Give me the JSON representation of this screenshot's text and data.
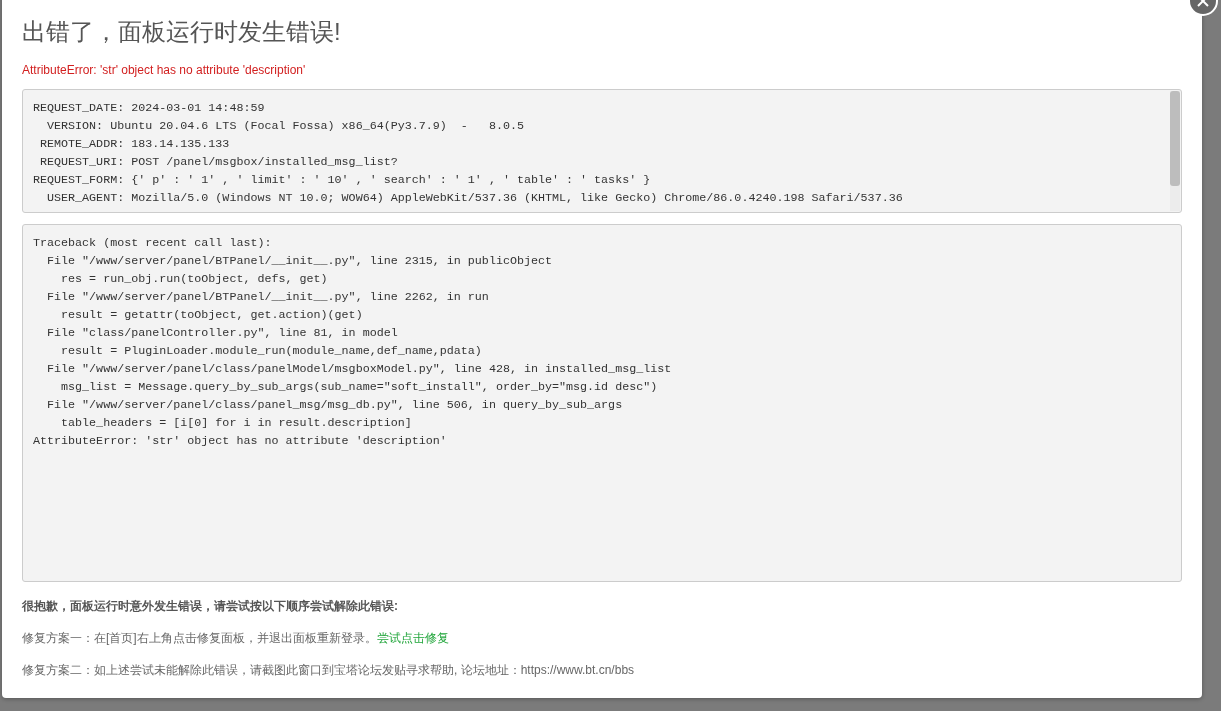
{
  "dialog": {
    "title": "出错了，面板运行时发生错误!",
    "error_message": "AttributeError: 'str' object has no attribute 'description'",
    "request_info": [
      "REQUEST_DATE: 2024-03-01 14:48:59",
      "  VERSION: Ubuntu 20.04.6 LTS (Focal Fossa) x86_64(Py3.7.9)  -   8.0.5",
      " REMOTE_ADDR: 183.14.135.133",
      " REQUEST_URI: POST /panel/msgbox/installed_msg_list?",
      "REQUEST_FORM: {' p' : ' 1' , ' limit' : ' 10' , ' search' : ' 1' , ' table' : ' tasks' }",
      "  USER_AGENT: Mozilla/5.0 (Windows NT 10.0; WOW64) AppleWebKit/537.36 (KHTML, like Gecko) Chrome/86.0.4240.198 Safari/537.36"
    ],
    "traceback": [
      "Traceback (most recent call last):",
      "  File \"/www/server/panel/BTPanel/__init__.py\", line 2315, in publicObject",
      "    res = run_obj.run(toObject, defs, get)",
      "  File \"/www/server/panel/BTPanel/__init__.py\", line 2262, in run",
      "    result = getattr(toObject, get.action)(get)",
      "  File \"class/panelController.py\", line 81, in model",
      "    result = PluginLoader.module_run(module_name,def_name,pdata)",
      "  File \"/www/server/panel/class/panelModel/msgboxModel.py\", line 428, in installed_msg_list",
      "    msg_list = Message.query_by_sub_args(sub_name=\"soft_install\", order_by=\"msg.id desc\")",
      "  File \"/www/server/panel/class/panel_msg/msg_db.py\", line 506, in query_by_sub_args",
      "    table_headers = [i[0] for i in result.description]",
      "AttributeError: 'str' object has no attribute 'description'"
    ],
    "help_heading": "很抱歉，面板运行时意外发生错误，请尝试按以下顺序尝试解除此错误:",
    "fixes": [
      {
        "text": "修复方案一：在[首页]右上角点击修复面板，并退出面板重新登录。",
        "link": "尝试点击修复"
      },
      {
        "text": "修复方案二：如上述尝试未能解除此错误，请截图此窗口到宝塔论坛发贴寻求帮助, 论坛地址：https://www.bt.cn/bbs"
      }
    ]
  }
}
